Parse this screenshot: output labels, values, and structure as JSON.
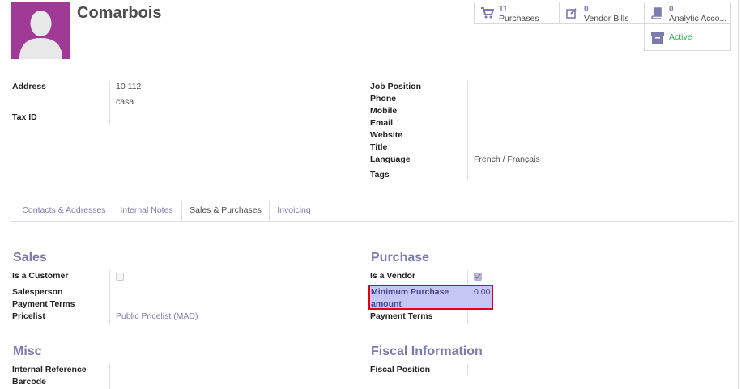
{
  "partner": {
    "name": "Comarbois"
  },
  "smart_buttons": {
    "purchases": {
      "count": "11",
      "label": "Purchases",
      "icon": "cart-icon"
    },
    "vendor_bills": {
      "count": "0",
      "label": "Vendor Bills",
      "icon": "edit-icon"
    },
    "analytic": {
      "count": "0",
      "label": "Analytic Acco...",
      "icon": "book-icon"
    },
    "active": {
      "label": "Active",
      "icon": "archive-icon",
      "color": "#2bb24c"
    }
  },
  "left_fields": {
    "address_label": "Address",
    "address_line1": "10 112",
    "address_line2": "casa",
    "tax_id_label": "Tax ID"
  },
  "right_fields": {
    "job_position": "Job Position",
    "phone": "Phone",
    "mobile": "Mobile",
    "email": "Email",
    "website": "Website",
    "title": "Title",
    "language": "Language",
    "language_value": "French / Français",
    "tags": "Tags"
  },
  "tabs": [
    {
      "label": "Contacts & Addresses"
    },
    {
      "label": "Internal Notes"
    },
    {
      "label": "Sales & Purchases"
    },
    {
      "label": "Invoicing"
    }
  ],
  "sales": {
    "heading": "Sales",
    "is_customer": "Is a Customer",
    "salesperson": "Salesperson",
    "payment_terms": "Payment Terms",
    "pricelist": "Pricelist",
    "pricelist_value": "Public Pricelist (MAD)"
  },
  "purchase": {
    "heading": "Purchase",
    "is_vendor": "Is a Vendor",
    "min_purchase_line1": "Minimum Purchase",
    "min_purchase_line2": "amount",
    "min_purchase_value": "0.00",
    "payment_terms": "Payment Terms"
  },
  "misc": {
    "heading": "Misc",
    "internal_reference": "Internal Reference",
    "barcode": "Barcode"
  },
  "fiscal": {
    "heading": "Fiscal Information",
    "fiscal_position": "Fiscal Position"
  },
  "colors": {
    "accent": "#7c7bad",
    "avatar_bg": "#a13a97",
    "highlight_border": "#e00019"
  }
}
